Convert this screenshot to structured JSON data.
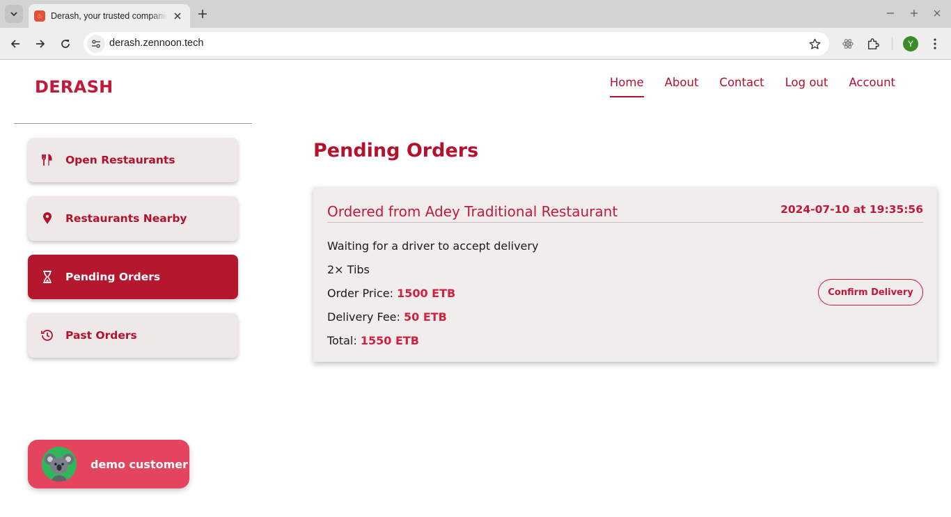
{
  "browser": {
    "tab_title": "Derash, your trusted companion",
    "url": "derash.zennoon.tech",
    "profile_initial": "Y",
    "icons": [
      "tab-search-icon",
      "close-icon",
      "plus-icon",
      "minimize-icon",
      "maximize-icon",
      "window-close-icon",
      "back-arrow-icon",
      "forward-arrow-icon",
      "reload-icon",
      "site-info-icon",
      "bookmark-star-icon",
      "react-devtools-icon",
      "extensions-puzzle-icon",
      "kebab-menu-icon"
    ]
  },
  "header": {
    "brand": "DERASH",
    "nav": [
      {
        "label": "Home",
        "active": true
      },
      {
        "label": "About",
        "active": false
      },
      {
        "label": "Contact",
        "active": false
      },
      {
        "label": "Log out",
        "active": false
      },
      {
        "label": "Account",
        "active": false
      }
    ]
  },
  "sidebar": {
    "items": [
      {
        "label": "Open Restaurants",
        "icon": "utensils-icon",
        "active": false
      },
      {
        "label": "Restaurants Nearby",
        "icon": "location-pin-icon",
        "active": false
      },
      {
        "label": "Pending Orders",
        "icon": "hourglass-icon",
        "active": true
      },
      {
        "label": "Past Orders",
        "icon": "history-icon",
        "active": false
      }
    ],
    "user": {
      "name": "demo customer",
      "avatar": "koala-avatar-icon"
    }
  },
  "main": {
    "heading": "Pending Orders",
    "order": {
      "title": "Ordered from Adey Traditional Restaurant",
      "date": "2024-07-10 at 19:35:56",
      "status": "Waiting for a driver to accept delivery",
      "items": "2× Tibs",
      "price_label": "Order Price:",
      "price_value": "1500 ETB",
      "fee_label": "Delivery Fee:",
      "fee_value": "50 ETB",
      "total_label": "Total:",
      "total_value": "1550 ETB",
      "confirm_label": "Confirm Delivery"
    }
  },
  "colors": {
    "brand": "#c0193a",
    "active_bg": "#b5172f",
    "card_bg": "#f2eded",
    "user_chip": "#e5445e"
  }
}
